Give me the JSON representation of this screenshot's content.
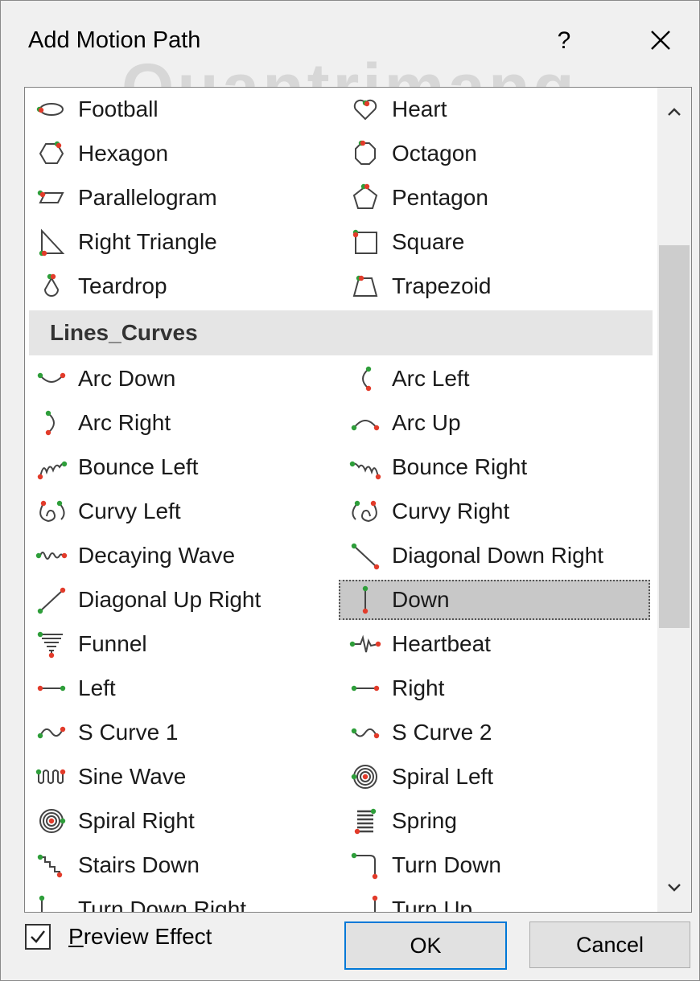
{
  "dialog": {
    "title": "Add Motion Path",
    "help_label": "?",
    "ok_label": "OK",
    "cancel_label": "Cancel",
    "preview_label": "Preview Effect",
    "preview_checked": true,
    "accent_color": "#0078d7",
    "marker_start_color": "#2e9e3a",
    "marker_end_color": "#e23b2a"
  },
  "watermark": "Quantrimang",
  "list": {
    "group_header": "Lines_Curves",
    "shapes": [
      {
        "label": "Football",
        "icon": "football-icon"
      },
      {
        "label": "Heart",
        "icon": "heart-icon"
      },
      {
        "label": "Hexagon",
        "icon": "hexagon-icon"
      },
      {
        "label": "Octagon",
        "icon": "octagon-icon"
      },
      {
        "label": "Parallelogram",
        "icon": "parallelogram-icon"
      },
      {
        "label": "Pentagon",
        "icon": "pentagon-icon"
      },
      {
        "label": "Right Triangle",
        "icon": "right-triangle-icon"
      },
      {
        "label": "Square",
        "icon": "square-icon"
      },
      {
        "label": "Teardrop",
        "icon": "teardrop-icon"
      },
      {
        "label": "Trapezoid",
        "icon": "trapezoid-icon"
      }
    ],
    "lines": [
      {
        "label": "Arc Down",
        "icon": "arc-down-icon"
      },
      {
        "label": "Arc Left",
        "icon": "arc-left-icon"
      },
      {
        "label": "Arc Right",
        "icon": "arc-right-icon"
      },
      {
        "label": "Arc Up",
        "icon": "arc-up-icon"
      },
      {
        "label": "Bounce Left",
        "icon": "bounce-left-icon"
      },
      {
        "label": "Bounce Right",
        "icon": "bounce-right-icon"
      },
      {
        "label": "Curvy Left",
        "icon": "curvy-left-icon"
      },
      {
        "label": "Curvy Right",
        "icon": "curvy-right-icon"
      },
      {
        "label": "Decaying Wave",
        "icon": "decaying-wave-icon"
      },
      {
        "label": "Diagonal Down Right",
        "icon": "diagonal-down-right-icon"
      },
      {
        "label": "Diagonal Up Right",
        "icon": "diagonal-up-right-icon"
      },
      {
        "label": "Down",
        "icon": "down-icon",
        "selected": true
      },
      {
        "label": "Funnel",
        "icon": "funnel-icon"
      },
      {
        "label": "Heartbeat",
        "icon": "heartbeat-icon"
      },
      {
        "label": "Left",
        "icon": "left-icon"
      },
      {
        "label": "Right",
        "icon": "right-icon"
      },
      {
        "label": "S Curve 1",
        "icon": "s-curve-1-icon"
      },
      {
        "label": "S Curve 2",
        "icon": "s-curve-2-icon"
      },
      {
        "label": "Sine Wave",
        "icon": "sine-wave-icon"
      },
      {
        "label": "Spiral Left",
        "icon": "spiral-left-icon"
      },
      {
        "label": "Spiral Right",
        "icon": "spiral-right-icon"
      },
      {
        "label": "Spring",
        "icon": "spring-icon"
      },
      {
        "label": "Stairs Down",
        "icon": "stairs-down-icon"
      },
      {
        "label": "Turn Down",
        "icon": "turn-down-icon"
      },
      {
        "label": "Turn Down Right",
        "icon": "turn-down-right-icon"
      },
      {
        "label": "Turn Up",
        "icon": "turn-up-icon"
      }
    ]
  }
}
